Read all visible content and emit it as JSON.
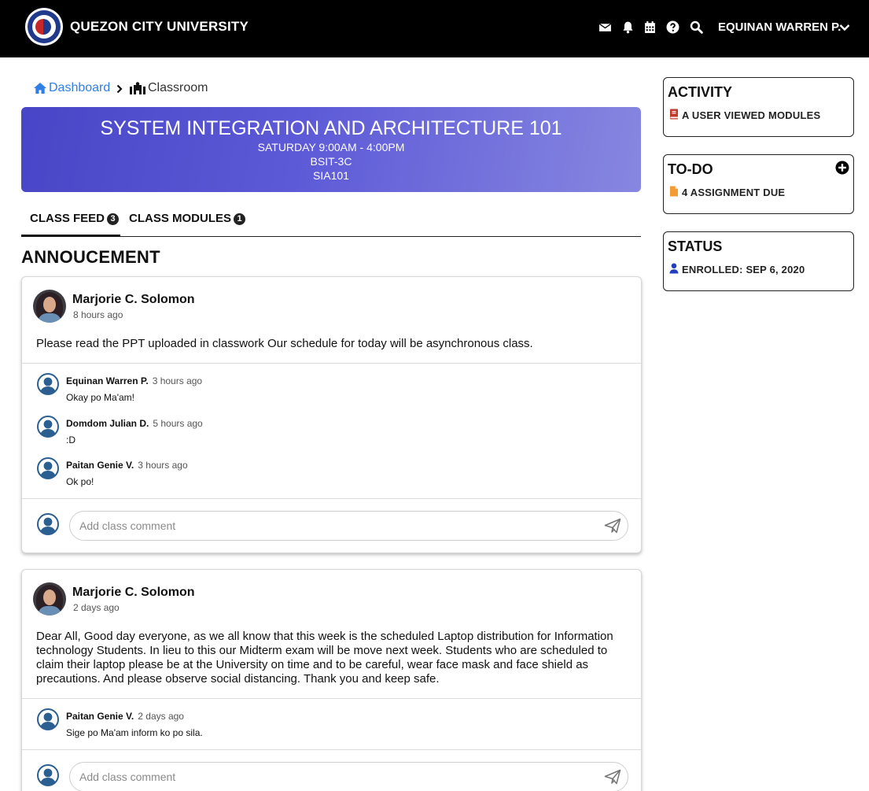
{
  "header": {
    "brand": "QUEZON CITY UNIVERSITY",
    "user_name": "EQUINAN WARREN P.",
    "icons": [
      "envelope-icon",
      "bell-icon",
      "calendar-icon",
      "help-icon",
      "search-icon",
      "chevron-down-icon"
    ]
  },
  "breadcrumb": {
    "home": "Dashboard",
    "current": "Classroom"
  },
  "course": {
    "title": "SYSTEM INTEGRATION AND ARCHITECTURE 101",
    "schedule": "SATURDAY 9:00AM - 4:00PM",
    "section": "BSIT-3C",
    "code": "SIA101"
  },
  "tabs": [
    {
      "label": "CLASS FEED",
      "count": "3"
    },
    {
      "label": "CLASS MODULES",
      "count": "1"
    }
  ],
  "section_title": "ANNOUCEMENT",
  "comment_placeholder": "Add class comment",
  "posts": [
    {
      "author": "Marjorie C. Solomon",
      "time": "8 hours ago",
      "body": "Please read the PPT uploaded in classwork Our schedule for today will be asynchronous class.",
      "comments": [
        {
          "author": "Equinan Warren P.",
          "time": "3 hours ago",
          "text": "Okay po Ma'am!"
        },
        {
          "author": "Domdom Julian D.",
          "time": "5 hours ago",
          "text": ":D"
        },
        {
          "author": "Paitan Genie V.",
          "time": "3 hours ago",
          "text": "Ok po!"
        }
      ]
    },
    {
      "author": "Marjorie C. Solomon",
      "time": "2 days ago",
      "body": "Dear All, Good day everyone, as we all know that this week is the scheduled Laptop distribution for Information technology Students. In lieu to this our Midterm exam will be move next week. Students who are scheduled to claim their laptop please be at the University on time and to be careful, wear face mask and face shield as precautions. And please observe social distancing. Thank you and keep safe.",
      "comments": [
        {
          "author": "Paitan Genie V.",
          "time": "2 days ago",
          "text": "Sige po Ma'am inform ko po sila."
        }
      ]
    }
  ],
  "sidebar": {
    "activity": {
      "title": "ACTIVITY",
      "text": "A USER VIEWED MODULES",
      "icon": "book-icon",
      "icon_color": "#c0392b"
    },
    "todo": {
      "title": "TO-DO",
      "text": "4 ASSIGNMENT DUE",
      "icon": "file-icon",
      "icon_color": "#f39c34"
    },
    "status": {
      "title": "STATUS",
      "text": "ENROLLED: SEP 6, 2020",
      "icon": "user-icon",
      "icon_color": "#1f3fbf"
    }
  },
  "colors": {
    "accent": "#2f7fe6",
    "banner_start": "#4846c6",
    "banner_end": "#8787e0"
  }
}
